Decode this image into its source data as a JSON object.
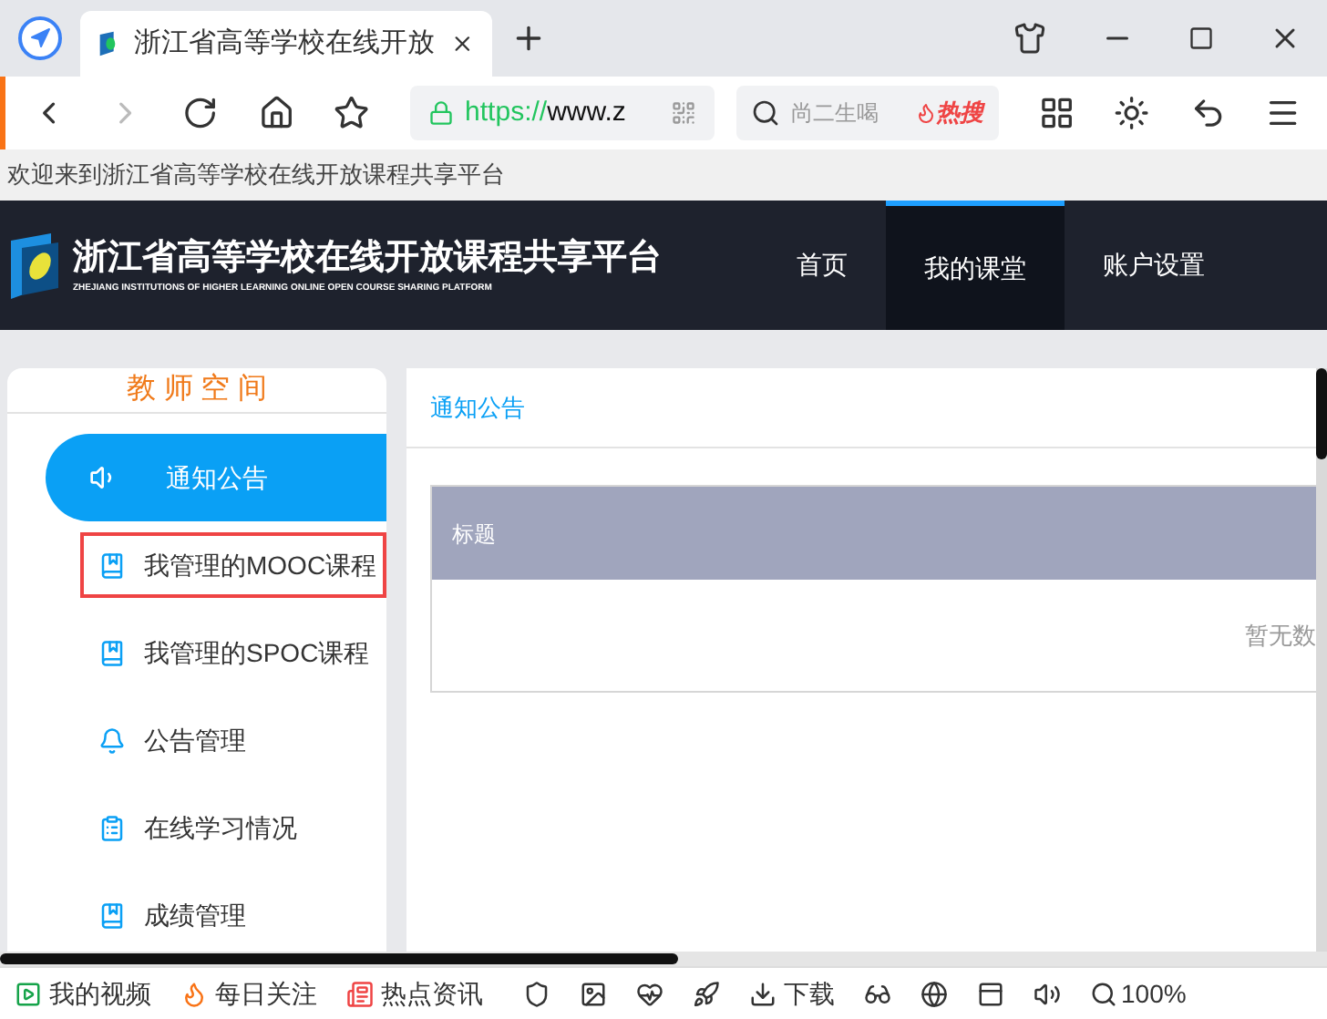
{
  "browser": {
    "tab_title": "浙江省高等学校在线开放",
    "url_scheme": "https://",
    "url_rest": "www.z",
    "search_placeholder": "尚二生喝",
    "hot_label": "热搜"
  },
  "welcome": "欢迎来到浙江省高等学校在线开放课程共享平台",
  "header": {
    "title": "浙江省高等学校在线开放课程共享平台",
    "subtitle": "ZHEJIANG INSTITUTIONS OF HIGHER LEARNING ONLINE OPEN COURSE SHARING PLATFORM",
    "nav": [
      {
        "label": "首页",
        "selected": false
      },
      {
        "label": "我的课堂",
        "selected": true
      },
      {
        "label": "账户设置",
        "selected": false
      }
    ]
  },
  "sidebar": {
    "title": "教 师 空 间",
    "items": [
      {
        "label": "通知公告",
        "kind": "speaker",
        "selected": true,
        "highlighted": false
      },
      {
        "label": "我管理的MOOC课程",
        "kind": "book",
        "selected": false,
        "highlighted": true
      },
      {
        "label": "我管理的SPOC课程",
        "kind": "book",
        "selected": false,
        "highlighted": false
      },
      {
        "label": "公告管理",
        "kind": "bell",
        "selected": false,
        "highlighted": false
      },
      {
        "label": "在线学习情况",
        "kind": "clipboard",
        "selected": false,
        "highlighted": false
      },
      {
        "label": "成绩管理",
        "kind": "book",
        "selected": false,
        "highlighted": false
      }
    ]
  },
  "content": {
    "breadcrumb": "通知公告",
    "table": {
      "columns": [
        "标题"
      ],
      "empty_text": "暂无数"
    }
  },
  "status_bar": [
    {
      "label": "我的视频",
      "kind": "play"
    },
    {
      "label": "每日关注",
      "kind": "flame"
    },
    {
      "label": "热点资讯",
      "kind": "news"
    },
    {
      "label": "下载",
      "kind": "download"
    },
    {
      "label": "100%",
      "kind": "zoom"
    }
  ]
}
